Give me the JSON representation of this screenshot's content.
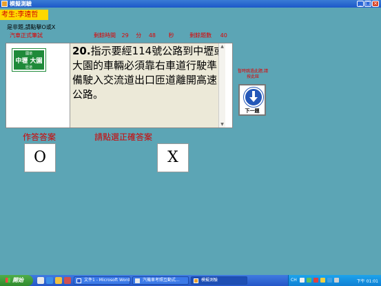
{
  "window": {
    "title": "模擬測驗",
    "app_icon": "app-window-icon",
    "controls": [
      "_",
      "□",
      "×"
    ]
  },
  "exam": {
    "examinee": "考生:李遠哲",
    "instruction": "是非題,請點擊O或X",
    "type": "汽車正式筆試",
    "time_label": "剩餘時間",
    "time_minutes": "29",
    "minutes_unit": "分",
    "time_seconds": "48",
    "seconds_unit": "秒",
    "remaining_label": "剩餘題數",
    "remaining_count": "40"
  },
  "sign": {
    "top": "國道",
    "main": "中壢 大園",
    "bottom": "匝道"
  },
  "question": {
    "number": "20.",
    "text": "指示要經114號公路到中壢或大園的車輛必須靠右車道行駛準備駛入交流道出口匝道離開高速公路。"
  },
  "abandon_hint": "暫時跳過此題,請按此鈕",
  "next_button": {
    "label": "下一題",
    "icon": "down-arrow-icon"
  },
  "answer_label": "作答答案",
  "select_label": "請點選正確答案",
  "answer_buttons": {
    "o": "O",
    "x": "X"
  },
  "taskbar": {
    "start": "開始",
    "tasks": [
      {
        "label": "文件1 - Microsoft Word",
        "icon": "word-icon"
      },
      {
        "label": "汽機車考照互動式...",
        "icon": "browser-icon"
      },
      {
        "label": "模擬測驗",
        "icon": "app-window-icon"
      }
    ],
    "lang": "CH",
    "clock": "下午 01:01"
  },
  "colors": {
    "background": "#5ca5b5",
    "accent_red": "#d00000",
    "name_bg": "#ffd800",
    "sign_green": "#1f8a3a",
    "next_blue": "#2457b8"
  }
}
